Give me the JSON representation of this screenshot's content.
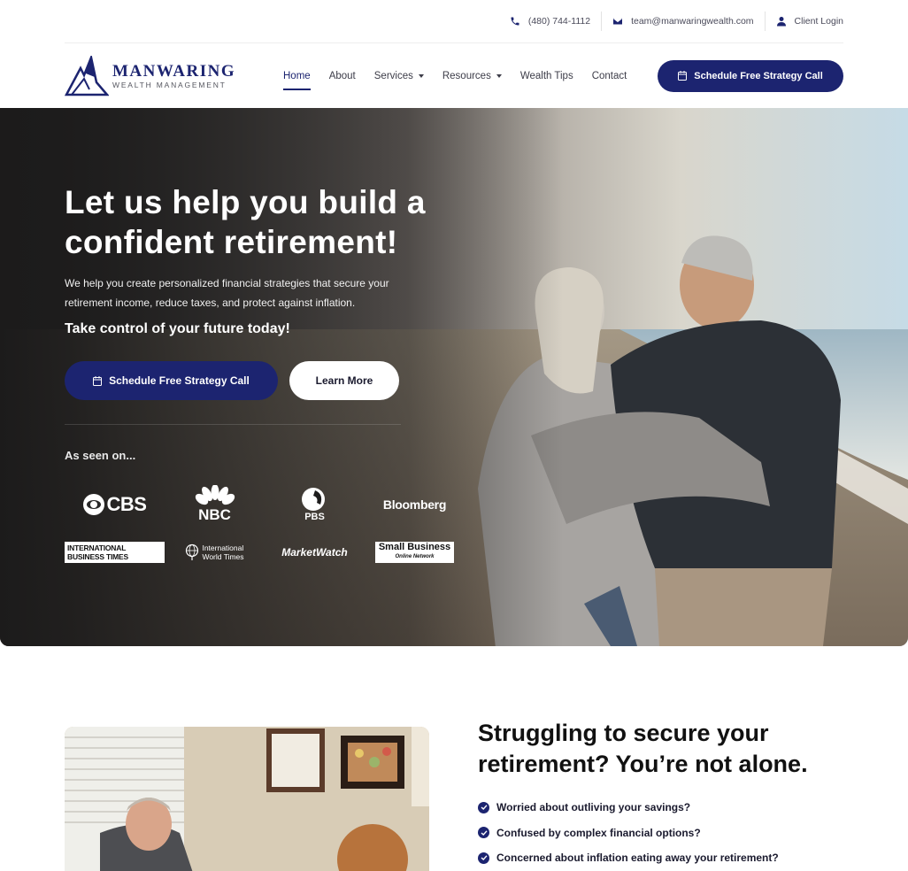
{
  "topbar": {
    "phone": "(480) 744-1112",
    "email": "team@manwaringwealth.com",
    "login": "Client Login"
  },
  "brand": {
    "name": "MANWARING",
    "tagline": "WEALTH MANAGEMENT"
  },
  "nav": {
    "items": [
      {
        "label": "Home",
        "active": true
      },
      {
        "label": "About"
      },
      {
        "label": "Services",
        "dropdown": true
      },
      {
        "label": "Resources",
        "dropdown": true
      },
      {
        "label": "Wealth Tips"
      },
      {
        "label": "Contact"
      }
    ],
    "cta": "Schedule Free Strategy Call"
  },
  "hero": {
    "title": "Let us help you build a confident retirement!",
    "description": "We help you create personalized financial strategies that secure your retirement income, reduce taxes, and protect against inflation.",
    "tagline": "Take control of your future today!",
    "primary_button": "Schedule Free Strategy Call",
    "secondary_button": "Learn More",
    "seen_on": "As seen on..."
  },
  "media": {
    "cbs": "CBS",
    "nbc": "NBC",
    "pbs": "PBS",
    "bloomberg": "Bloomberg",
    "ibt": "INTERNATIONAL BUSINESS TIMES",
    "iwt_1": "International",
    "iwt_2": "World Times",
    "marketwatch": "MarketWatch",
    "smb_1": "Small Business",
    "smb_2": "Online Network"
  },
  "struggle": {
    "title": "Struggling to secure your retirement? You’re not alone.",
    "items": [
      "Worried about outliving your savings?",
      "Confused by complex financial options?",
      "Concerned about inflation eating away your retirement?"
    ]
  },
  "colors": {
    "brand_navy": "#1c2470",
    "hero_dark": "#1d1c1c"
  }
}
